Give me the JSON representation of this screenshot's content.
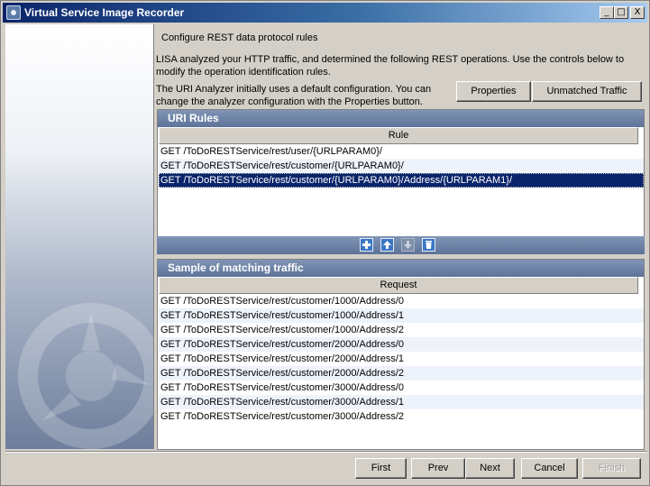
{
  "window": {
    "title": "Virtual Service Image Recorder",
    "minimize_glyph": "_",
    "maximize_glyph": "□",
    "close_glyph": "X"
  },
  "page": {
    "heading": "Configure REST data protocol rules",
    "intro": "LISA analyzed your HTTP traffic, and determined the following REST operations. Use the controls below to modify the operation identification rules.",
    "analyzer_note": "The URI Analyzer initially uses a default configuration. You can change the analyzer configuration with the Properties button.",
    "properties_label": "Properties",
    "unmatched_label": "Unmatched Traffic"
  },
  "uri_rules": {
    "title": "URI Rules",
    "column": "Rule",
    "rows": [
      "GET /ToDoRESTService/rest/user/{URLPARAM0}/",
      "GET /ToDoRESTService/rest/customer/{URLPARAM0}/",
      "GET /ToDoRESTService/rest/customer/{URLPARAM0}/Address/{URLPARAM1}/"
    ],
    "selected_index": 2,
    "toolbar_icons": [
      "add-icon",
      "move-up-icon",
      "move-down-icon",
      "delete-icon"
    ]
  },
  "sample": {
    "title": "Sample of matching traffic",
    "column": "Request",
    "rows": [
      "GET /ToDoRESTService/rest/customer/1000/Address/0",
      "GET /ToDoRESTService/rest/customer/1000/Address/1",
      "GET /ToDoRESTService/rest/customer/1000/Address/2",
      "GET /ToDoRESTService/rest/customer/2000/Address/0",
      "GET /ToDoRESTService/rest/customer/2000/Address/1",
      "GET /ToDoRESTService/rest/customer/2000/Address/2",
      "GET /ToDoRESTService/rest/customer/3000/Address/0",
      "GET /ToDoRESTService/rest/customer/3000/Address/1",
      "GET /ToDoRESTService/rest/customer/3000/Address/2"
    ]
  },
  "footer": {
    "first": "First",
    "prev": "Prev",
    "next": "Next",
    "cancel": "Cancel",
    "finish": "Finish"
  },
  "colors": {
    "selection": "#0a246a",
    "panel_header": "#6c81a6",
    "tool_button": "#3b78c4"
  }
}
